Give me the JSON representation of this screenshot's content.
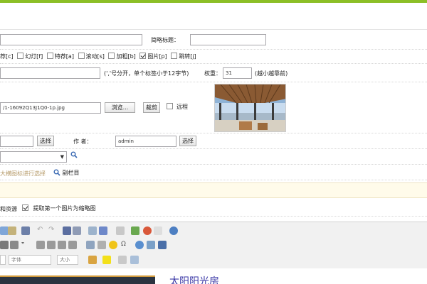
{
  "row_title": {
    "short_title_label": "简略标题：",
    "short_title_value": ""
  },
  "flags": [
    {
      "label": "荐[c]",
      "checked": false
    },
    {
      "label": "幻灯[f]",
      "checked": false
    },
    {
      "label": "特荐[a]",
      "checked": false
    },
    {
      "label": "滚动[s]",
      "checked": false
    },
    {
      "label": "加粗[b]",
      "checked": false
    },
    {
      "label": "图片[p]",
      "checked": true
    },
    {
      "label": "跳转[j]",
      "checked": false
    }
  ],
  "tags_row": {
    "tags_value": "",
    "tags_hint": "(','号分开，单个标签小于12字节)",
    "weight_label": "权重：",
    "weight_value": "31",
    "weight_hint": "(越小越靠前)"
  },
  "thumb_row": {
    "path_value": "/1-16092Q13J1Q0-1p.jpg",
    "browse_label": "浏览...",
    "crop_label": "裁剪",
    "remote_label": "远程",
    "remote_checked": false
  },
  "source_row": {
    "source_value": "",
    "source_select_label": "选择",
    "author_label": "作  者：",
    "author_value": "admin",
    "author_select_label": "选择"
  },
  "column_row": {
    "select_value": "",
    "arrow": "▼"
  },
  "subcolumn_row": {
    "hint": "大横图标进行选择",
    "sub_label": "副栏目"
  },
  "options_row": {
    "resource_label": "和资源",
    "extract_label": "提取第一个图片为缩略图",
    "extract_checked": true
  },
  "editor": {
    "font_label": "字体",
    "size_label": "大小",
    "content_heading": "太阳阳光房"
  },
  "colors": {
    "accent": "#8cbf26",
    "link": "#3a37a6"
  }
}
